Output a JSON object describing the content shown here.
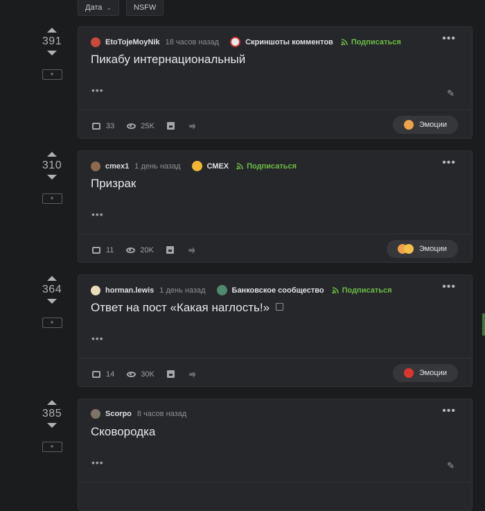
{
  "filters": {
    "date_label": "Дата",
    "nsfw_label": "NSFW"
  },
  "posts": [
    {
      "rating": "391",
      "author": "EtoTojeMoyNik",
      "time": "18 часов назад",
      "community": "Скриншоты комментов",
      "subscribe": "Подписаться",
      "title": "Пикабу интернациональный",
      "comments": "33",
      "views": "25K",
      "emotions": "Эмоции"
    },
    {
      "rating": "310",
      "author": "cmex1",
      "time": "1 день назад",
      "community": "СМЕХ",
      "subscribe": "Подписаться",
      "title": "Призрак",
      "comments": "11",
      "views": "20K",
      "emotions": "Эмоции"
    },
    {
      "rating": "364",
      "author": "horman.lewis",
      "time": "1 день назад",
      "community": "Банковское сообщество",
      "subscribe": "Подписаться",
      "title": "Ответ на пост «Какая наглость!»",
      "comments": "14",
      "views": "30K",
      "emotions": "Эмоции"
    },
    {
      "rating": "385",
      "author": "Scorpo",
      "time": "8 часов назад",
      "title": "Сковородка"
    }
  ],
  "colors": {
    "accent_green": "#6bbd45",
    "background": "#1b1c1e",
    "card": "#26272a"
  }
}
